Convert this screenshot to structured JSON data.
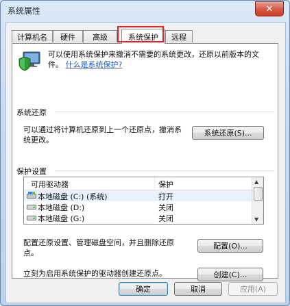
{
  "window": {
    "title": "系统属性",
    "close_glyph": "✕"
  },
  "tabs": [
    {
      "label": "计算机名",
      "active": false
    },
    {
      "label": "硬件",
      "active": false
    },
    {
      "label": "高级",
      "active": false
    },
    {
      "label": "系统保护",
      "active": true
    },
    {
      "label": "远程",
      "active": false
    }
  ],
  "intro": {
    "text": "可以使用系统保护来撤消不需要的系统更改，还原以前版本的文件。",
    "link": "什么是系统保护?"
  },
  "restore": {
    "heading": "系统还原",
    "description": "可以通过将计算机还原到上一个还原点，撤消系统更改。",
    "button": "系统还原(S)..."
  },
  "protection": {
    "heading": "保护设置",
    "columns": [
      "可用驱动器",
      "保护"
    ],
    "drives": [
      {
        "name": "本地磁盘  (C:) (系统)",
        "protection": "打开",
        "icon": "system-drive-icon"
      },
      {
        "name": "本地磁盘  (D:)",
        "protection": "关闭",
        "icon": "drive-icon"
      },
      {
        "name": "本地磁盘  (G:)",
        "protection": "关闭",
        "icon": "drive-icon"
      }
    ],
    "configure_text": "配置还原设置、管理磁盘空间，并且删除还原点。",
    "configure_button": "配置(O)...",
    "create_text": "立刻为启用系统保护的驱动器创建还原点。",
    "create_button": "创建(C)..."
  },
  "footer": {
    "ok": "确定",
    "cancel": "取消",
    "apply": "应用(A)"
  },
  "colors": {
    "highlight": "#e32222",
    "link": "#1d5fc4",
    "title_bar": "#c8dbf1"
  }
}
